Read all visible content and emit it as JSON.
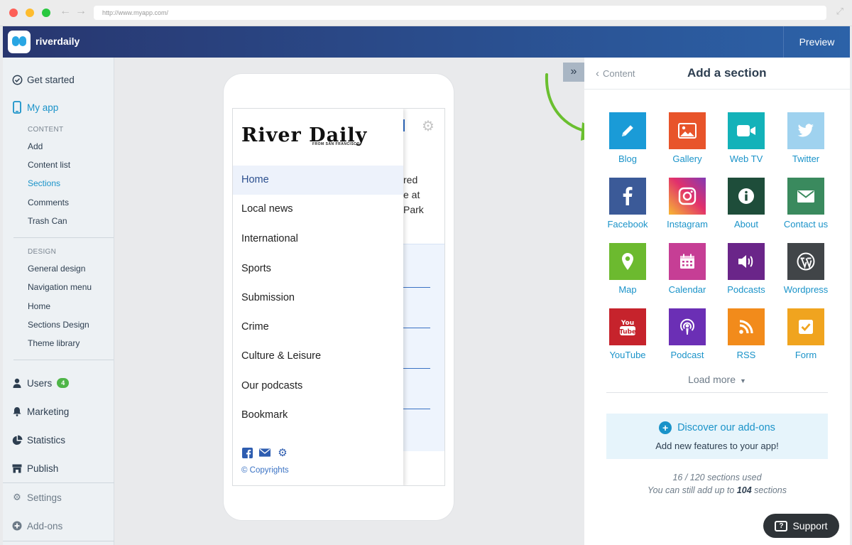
{
  "browser": {
    "url": "http://www.myapp.com/"
  },
  "topbar": {
    "app_name": "riverdaily",
    "preview_label": "Preview"
  },
  "sidebar": {
    "get_started": "Get started",
    "my_app": "My app",
    "content_label": "CONTENT",
    "content_items": [
      "Add",
      "Content list",
      "Sections",
      "Comments",
      "Trash Can"
    ],
    "design_label": "DESIGN",
    "design_items": [
      "General design",
      "Navigation menu",
      "Home",
      "Sections Design",
      "Theme library"
    ],
    "users": "Users",
    "users_badge": "4",
    "marketing": "Marketing",
    "statistics": "Statistics",
    "publish": "Publish",
    "settings": "Settings",
    "addons": "Add-ons"
  },
  "phone": {
    "logo_text": "River Daily",
    "logo_sub": "FROM SAN FRANCISCO",
    "menu": [
      "Home",
      "Local news",
      "International",
      "Sports",
      "Submission",
      "Crime",
      "Culture & Leisure",
      "Our podcasts",
      "Bookmark"
    ],
    "bg_text": [
      "red",
      "e at",
      "Park"
    ],
    "copyright": "© Copyrights"
  },
  "panel": {
    "back_label": "Content",
    "title": "Add a section",
    "tiles": [
      {
        "label": "Blog",
        "color": "#1a9bd7",
        "icon": "pencil-icon"
      },
      {
        "label": "Gallery",
        "color": "#e8542a",
        "icon": "image-icon"
      },
      {
        "label": "Web TV",
        "color": "#13b2b9",
        "icon": "video-camera-icon"
      },
      {
        "label": "Twitter",
        "color": "#9fd2ef",
        "icon": "twitter-bird-icon"
      },
      {
        "label": "Facebook",
        "color": "#3b5a98",
        "icon": "facebook-icon"
      },
      {
        "label": "Instagram",
        "color": "#d6336c",
        "icon": "instagram-icon"
      },
      {
        "label": "About",
        "color": "#1e4d3a",
        "icon": "info-icon"
      },
      {
        "label": "Contact us",
        "color": "#3a8a5e",
        "icon": "envelope-icon"
      },
      {
        "label": "Map",
        "color": "#6cba2f",
        "icon": "map-pin-icon"
      },
      {
        "label": "Calendar",
        "color": "#c63e95",
        "icon": "calendar-icon"
      },
      {
        "label": "Podcasts",
        "color": "#6a2589",
        "icon": "speaker-icon"
      },
      {
        "label": "Wordpress",
        "color": "#414548",
        "icon": "wordpress-icon"
      },
      {
        "label": "YouTube",
        "color": "#c6232c",
        "icon": "youtube-icon"
      },
      {
        "label": "Podcast",
        "color": "#6b2fb5",
        "icon": "podcast-icon"
      },
      {
        "label": "RSS",
        "color": "#f28b1b",
        "icon": "rss-icon"
      },
      {
        "label": "Form",
        "color": "#f0a41f",
        "icon": "checkbox-icon"
      }
    ],
    "load_more": "Load more",
    "addons_title": "Discover our add-ons",
    "addons_sub": "Add new features to your app!",
    "used_line": "16 / 120 sections used",
    "remaining_prefix": "You can still add up to",
    "remaining_count": "104",
    "remaining_suffix": "sections"
  },
  "support": {
    "label": "Support"
  }
}
